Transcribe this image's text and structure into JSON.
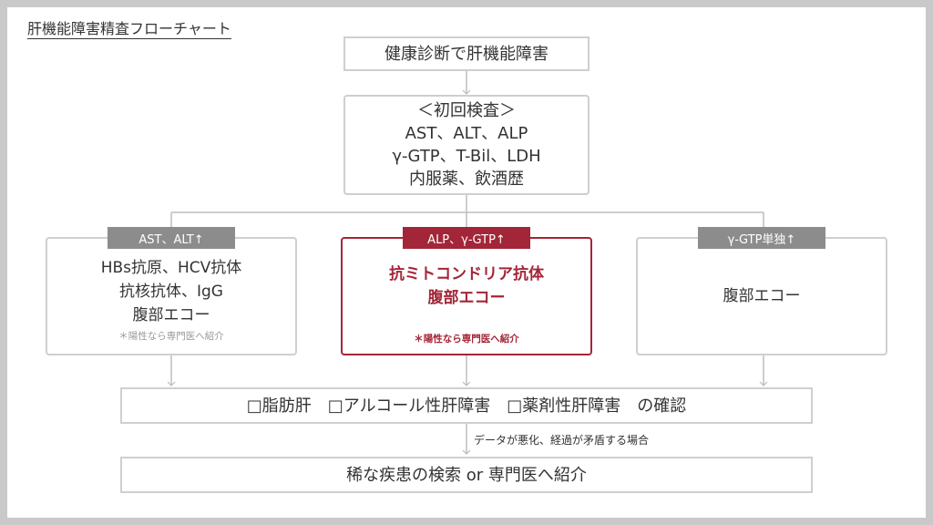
{
  "title": "肝機能障害精査フローチャート",
  "top_box": {
    "text": "健康診断で肝機能障害"
  },
  "initial_box": {
    "lines": [
      "＜初回検査＞",
      "AST、ALT、ALP",
      "γ-GTP、T-Bil、LDH",
      "内服薬、飲酒歴"
    ]
  },
  "branches": [
    {
      "tag": "AST、ALT↑",
      "lines": [
        "HBs抗原、HCV抗体",
        "抗核抗体、IgG",
        "腹部エコー"
      ],
      "note": "＊陽性なら専門医へ紹介"
    },
    {
      "tag": "ALP、γ-GTP↑",
      "lines": [
        "抗ミトコンドリア抗体",
        "腹部エコー"
      ],
      "note": "＊陽性なら専門医へ紹介"
    },
    {
      "tag": "γ-GTP単独↑",
      "lines": [
        "腹部エコー"
      ]
    }
  ],
  "check_box": {
    "text": "□脂肪肝　□アルコール性肝障害　□薬剤性肝障害　の確認"
  },
  "transition_note": "データが悪化、経過が矛盾する場合",
  "final_box": {
    "text": "稀な疾患の検索 or 専門医へ紹介"
  },
  "colors": {
    "accent": "#a32638",
    "border": "#cfcfcf",
    "tag_gray": "#8c8c8c",
    "connector": "#bdbdbd",
    "text": "#333333"
  }
}
